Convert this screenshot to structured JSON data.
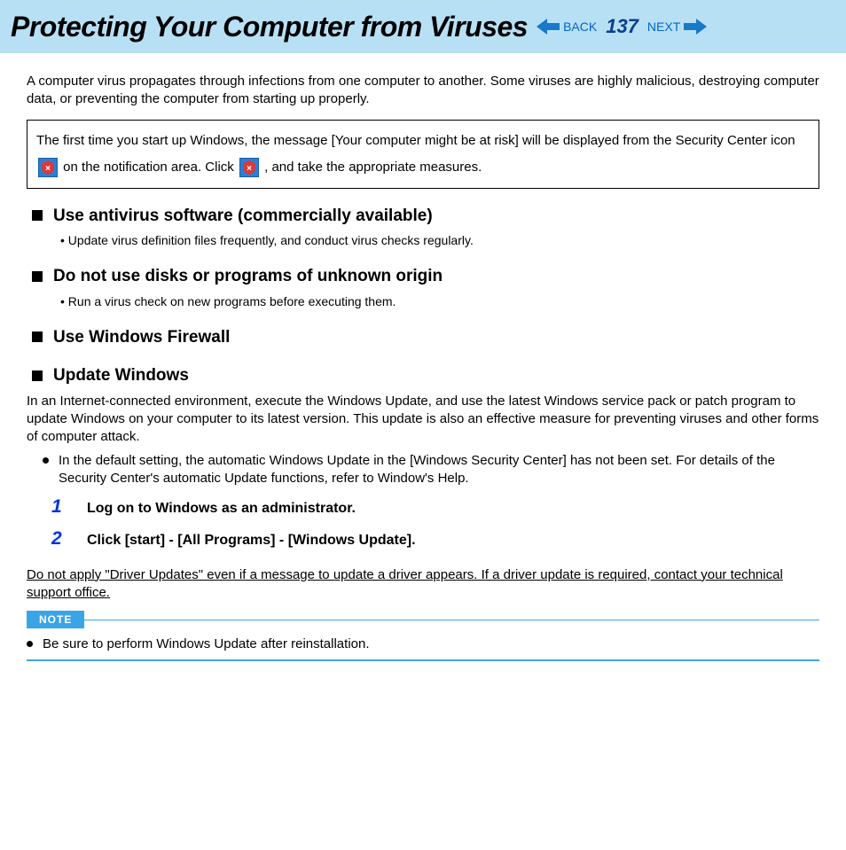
{
  "header": {
    "title": "Protecting Your Computer from Viruses",
    "back_label": "BACK",
    "next_label": "NEXT",
    "page_number": "137"
  },
  "intro": "A computer virus propagates through infections from one computer to another. Some viruses are highly malicious, destroying computer data, or preventing the computer from starting up properly.",
  "infobox": {
    "part1": "The first time you start up Windows, the message [Your computer might be at risk] will be displayed from the Security Center icon ",
    "part2": " on the notification area. Click ",
    "part3": ", and take the appropriate measures."
  },
  "sections": {
    "s1": {
      "heading": "Use antivirus software (commercially available)",
      "bullet": "Update virus definition files frequently, and conduct virus checks regularly."
    },
    "s2": {
      "heading": "Do not use disks or programs of unknown origin",
      "bullet": "Run a virus check on new programs before executing them."
    },
    "s3": {
      "heading": "Use Windows Firewall"
    },
    "s4": {
      "heading": "Update Windows",
      "para": "In an Internet-connected environment, execute the Windows Update, and use the latest Windows service pack or patch program to update Windows on your computer to its latest version. This update is also an effective measure for preventing viruses and other forms of computer attack.",
      "circle": "In the default setting, the automatic Windows Update in the [Windows Security Center] has not been set. For details of the Security Center's automatic Update functions, refer to Window's Help.",
      "steps": {
        "n1": "1",
        "t1": "Log on to Windows as an administrator.",
        "n2": "2",
        "t2": "Click [start] - [All Programs] - [Windows Update]."
      }
    }
  },
  "warning": "Do not apply \"Driver Updates\" even if a message to update a driver appears. If a driver update is required, contact your technical support office.",
  "note": {
    "label": "NOTE",
    "body": "Be sure to perform Windows Update after reinstallation."
  }
}
